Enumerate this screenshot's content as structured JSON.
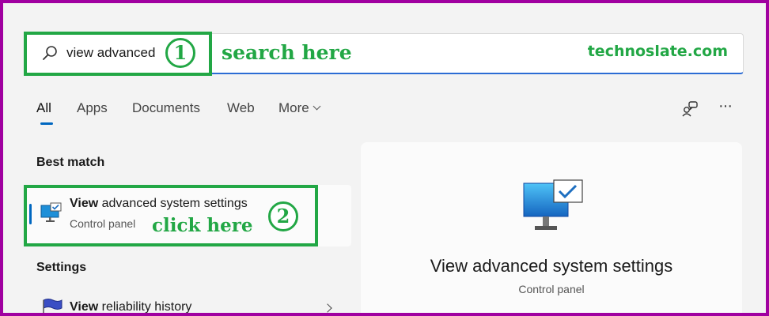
{
  "search": {
    "query": "view advanced",
    "annotation_num": "1",
    "annotation_label": "search here",
    "brand": "technoslate.com"
  },
  "tabs": [
    {
      "label": "All",
      "active": true
    },
    {
      "label": "Apps"
    },
    {
      "label": "Documents"
    },
    {
      "label": "Web"
    },
    {
      "label": "More"
    }
  ],
  "toolbar": {
    "share_icon": "chat-people-icon",
    "more_icon": "ellipsis-icon",
    "more_label": "···"
  },
  "best_match": {
    "heading": "Best match",
    "title_bold": "View",
    "title_rest": " advanced system settings",
    "subtitle": "Control panel",
    "annotation_num": "2",
    "annotation_label": "click here"
  },
  "settings": {
    "heading": "Settings",
    "item_bold": "View",
    "item_rest": " reliability history"
  },
  "preview": {
    "title": "View advanced system settings",
    "subtitle": "Control panel"
  },
  "colors": {
    "annotation": "#22a745",
    "accent": "#0067c0",
    "border": "#a000a0"
  }
}
